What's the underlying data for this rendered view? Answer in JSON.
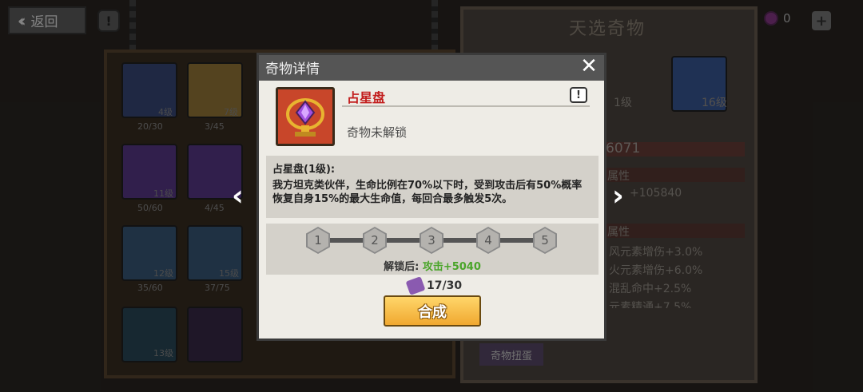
{
  "topbar": {
    "back_label": "返回",
    "info_label": "!"
  },
  "right_panel": {
    "title": "天选奇物",
    "gem_count": "0",
    "plus_label": "+",
    "level_a": "1级",
    "level_b": "16级",
    "power": "6071",
    "attr_header_1": "属性",
    "attr_line": "+105840",
    "attr_header_2": "属性",
    "bonuses": [
      "风元素增伤+3.0%",
      "火元素增伤+6.0%",
      "混乱命中+2.5%",
      "元素精通+7.5%"
    ],
    "gacha_label": "奇物扭蛋"
  },
  "left_panel": {
    "slots": [
      {
        "level": "4级",
        "count": "20/30"
      },
      {
        "level": "7级",
        "count": "3/45"
      },
      {
        "level": "11级",
        "count": "50/60"
      },
      {
        "level": "",
        "count": "4/45"
      },
      {
        "level": "12级",
        "count": "35/60"
      },
      {
        "level": "15级",
        "count": "37/75"
      },
      {
        "level": "13级",
        "count": ""
      }
    ]
  },
  "dialog": {
    "title": "奇物详情",
    "close_icon": "close-x",
    "item_name": "占星盘",
    "status": "奇物未解锁",
    "desc_title": "占星盘(1级):",
    "desc_body": "我方坦克类伙伴，生命比例在70%以下时，受到攻击后有50%概率恢复自身15%的最大生命值，每回合最多触发5次。",
    "stars": [
      "1",
      "2",
      "3",
      "4",
      "5"
    ],
    "unlock_label": "解锁后:",
    "unlock_value": "攻击+5040",
    "progress": "17/30",
    "craft_label": "合成",
    "info_label": "!"
  },
  "nav": {
    "prev": "‹",
    "next": "›"
  }
}
